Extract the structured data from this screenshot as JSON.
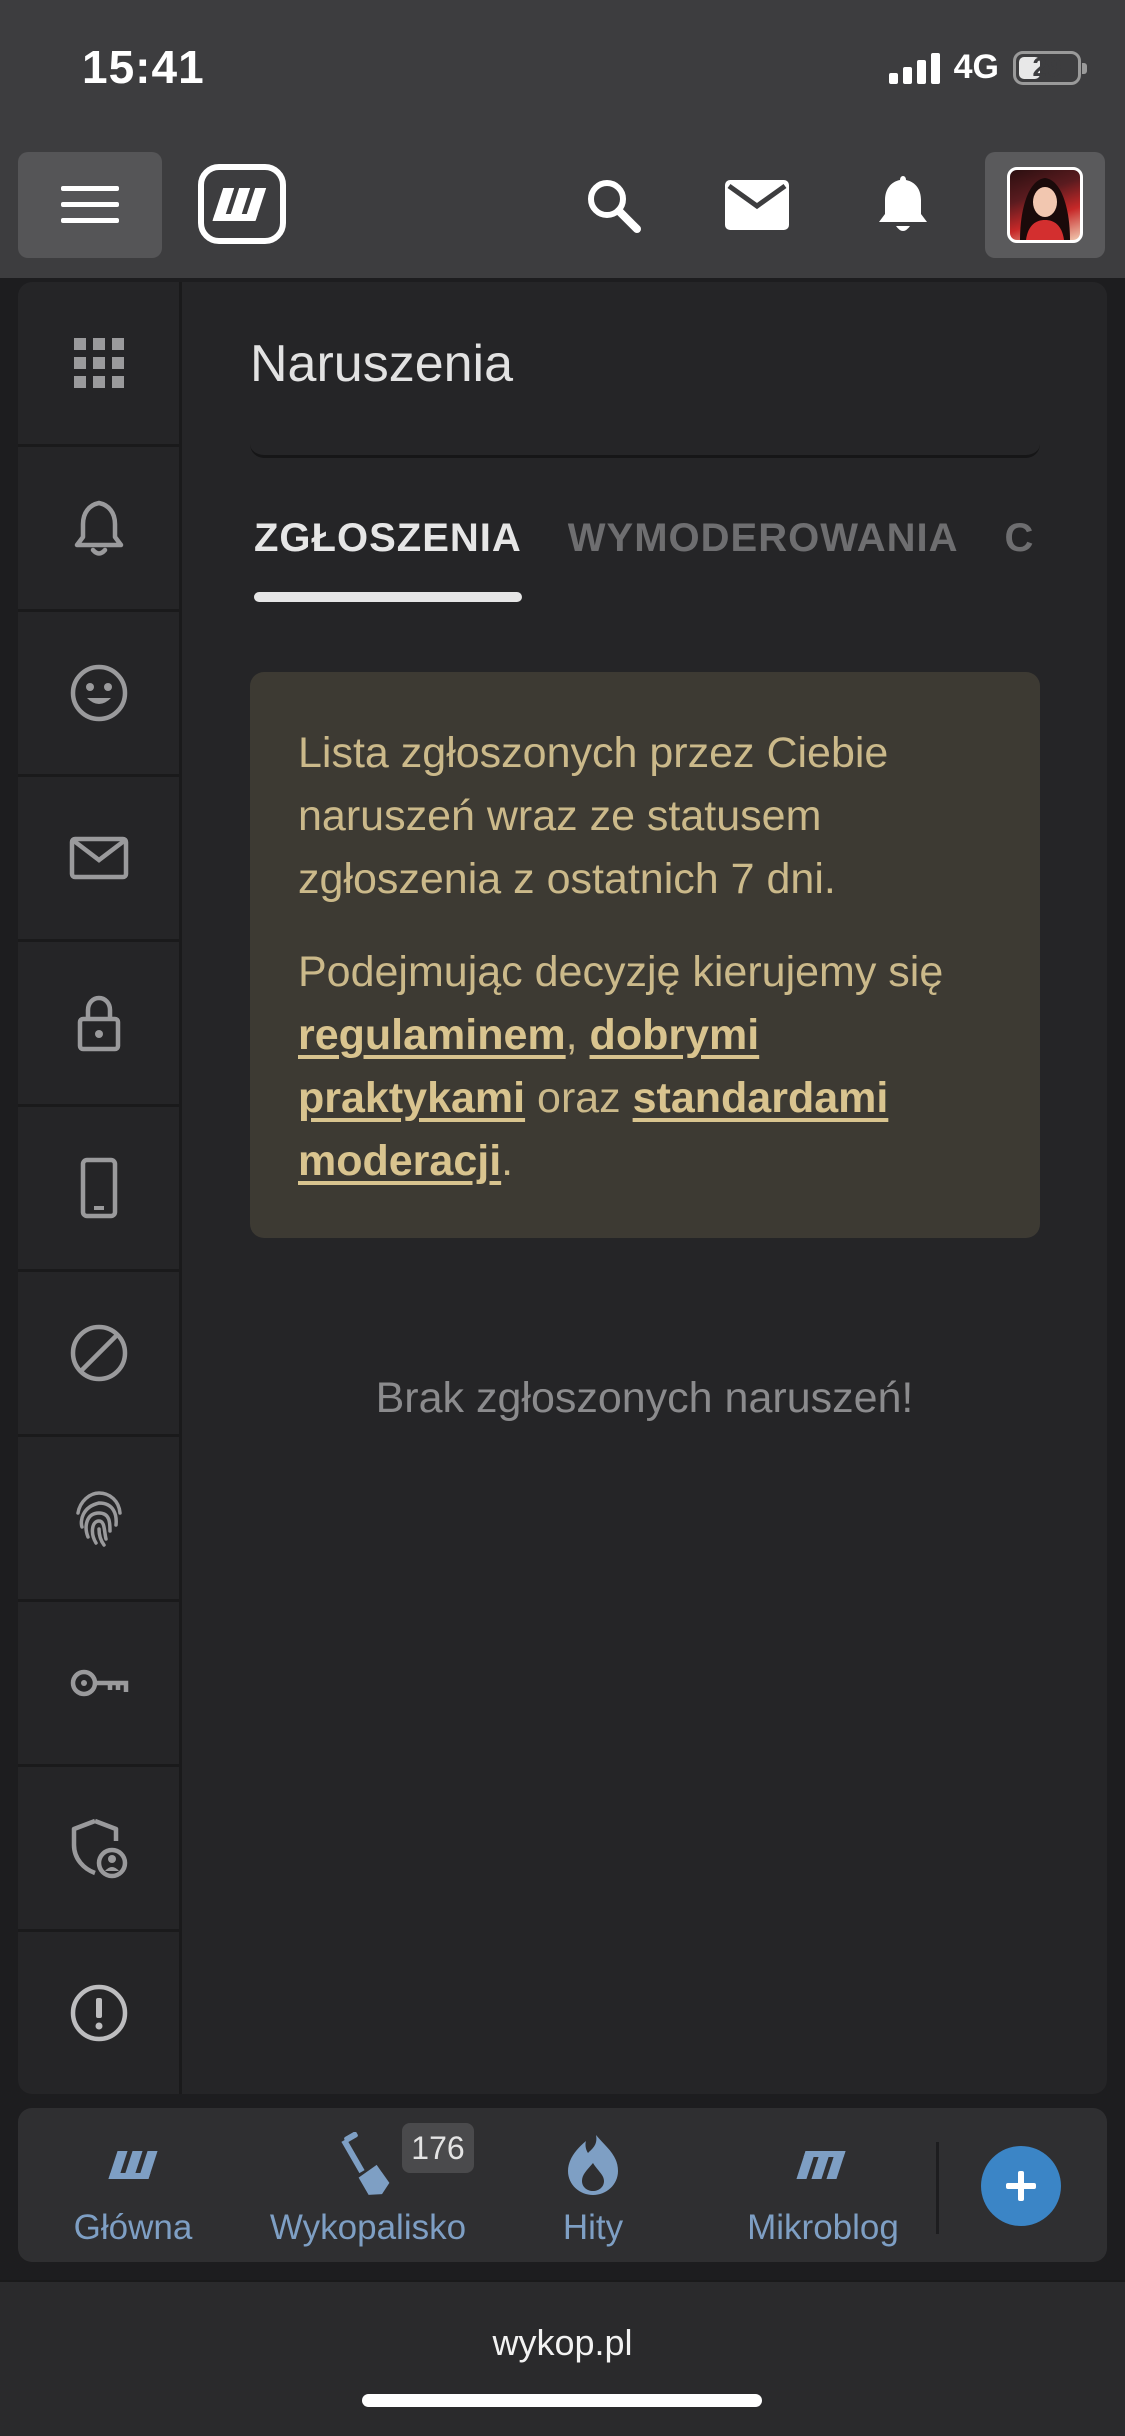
{
  "status_bar": {
    "time": "15:41",
    "network": "4G",
    "battery": "29"
  },
  "topbar": {
    "menu_icon": "hamburger-icon",
    "logo_icon": "wykop-logo",
    "search_icon": "search-icon",
    "mail_icon": "mail-icon",
    "notifications_icon": "bell-icon",
    "avatar_icon": "user-avatar"
  },
  "sidenav": {
    "items": [
      {
        "icon": "grid-icon"
      },
      {
        "icon": "bell-icon"
      },
      {
        "icon": "smiley-icon"
      },
      {
        "icon": "mail-icon"
      },
      {
        "icon": "lock-icon"
      },
      {
        "icon": "phone-icon"
      },
      {
        "icon": "block-icon"
      },
      {
        "icon": "fingerprint-icon"
      },
      {
        "icon": "key-icon"
      },
      {
        "icon": "shield-user-icon"
      },
      {
        "icon": "alert-icon"
      }
    ]
  },
  "page": {
    "title": "Naruszenia",
    "tabs": [
      {
        "label": "ZGŁOSZENIA",
        "active": true
      },
      {
        "label": "WYMODEROWANIA",
        "active": false
      },
      {
        "label": "C",
        "active": false
      }
    ],
    "info": {
      "paragraph1": "Lista zgłoszonych przez Ciebie naruszeń wraz ze statusem zgłoszenia z ostatnich 7 dni.",
      "paragraph2_prefix": "Podejmując decyzję kierujemy się ",
      "link_regulamin": "regulaminem",
      "sep1": ", ",
      "link_praktyki": "dobrymi praktykami",
      "sep2": " oraz ",
      "link_standardy": "standardami moderacji",
      "end": "."
    },
    "empty_message": "Brak zgłoszonych naruszeń!"
  },
  "bottom_nav": {
    "items": [
      {
        "label": "Główna",
        "icon": "wykop-home-icon"
      },
      {
        "label": "Wykopalisko",
        "icon": "shovel-icon",
        "badge": "176"
      },
      {
        "label": "Hity",
        "icon": "flame-icon"
      },
      {
        "label": "Mikroblog",
        "icon": "microblog-icon"
      }
    ],
    "add_icon": "plus-icon"
  },
  "browser": {
    "url": "wykop.pl"
  },
  "colors": {
    "accent": "#3b85c6",
    "info_bg": "#3d3a33",
    "info_text": "#cbb98a",
    "nav_label": "#7e9fc4"
  }
}
